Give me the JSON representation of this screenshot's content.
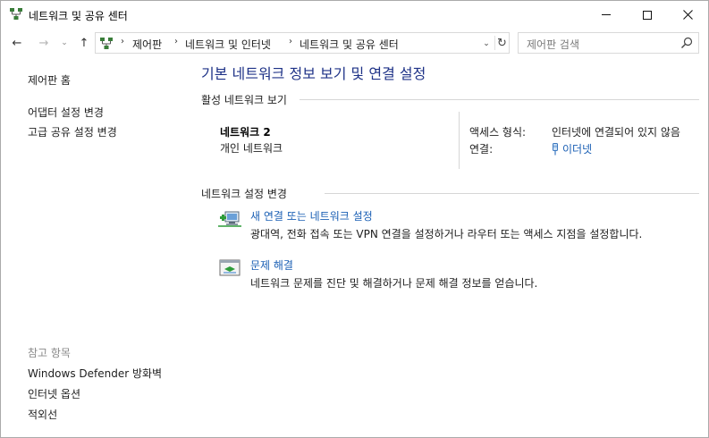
{
  "window": {
    "title": "네트워크 및 공유 센터"
  },
  "nav": {
    "back": "←",
    "forward": "→",
    "history": "⌄",
    "up": "↑",
    "breadcrumbs": [
      "제어판",
      "네트워크 및 인터넷",
      "네트워크 및 공유 센터"
    ],
    "breadcrumb_sep": "›",
    "refresh": "↻",
    "dropdown": "⌄"
  },
  "search": {
    "placeholder": "제어판 검색"
  },
  "left": {
    "home": "제어판 홈",
    "adapter": "어댑터 설정 변경",
    "advanced": "고급 공유 설정 변경",
    "see_also_head": "참고 항목",
    "see_also": [
      "Windows Defender 방화벽",
      "인터넷 옵션",
      "적외선"
    ]
  },
  "main": {
    "title": "기본 네트워크 정보 보기 및 연결 설정",
    "active_head": "활성 네트워크 보기",
    "network_name": "네트워크 2",
    "network_type": "개인 네트워크",
    "access_label": "액세스 형식:",
    "access_value": "인터넷에 연결되어 있지 않음",
    "conn_label": "연결:",
    "conn_value": "이더넷",
    "settings_head": "네트워크 설정 변경",
    "task1_link": "새 연결 또는 네트워크 설정",
    "task1_desc": "광대역, 전화 접속 또는 VPN 연결을 설정하거나 라우터 또는 액세스 지점을 설정합니다.",
    "task2_link": "문제 해결",
    "task2_desc": "네트워크 문제를 진단 및 해결하거나 문제 해결 정보를 얻습니다."
  },
  "colors": {
    "title_blue": "#1e3287",
    "link_blue": "#1a5fb4",
    "muted": "#8a8a8a"
  },
  "icons": {
    "title": "network-center-icon",
    "address": "control-panel-icon",
    "search": "search-icon",
    "connection": "ethernet-plug-icon",
    "task1": "new-connection-icon",
    "task2": "troubleshoot-icon"
  }
}
